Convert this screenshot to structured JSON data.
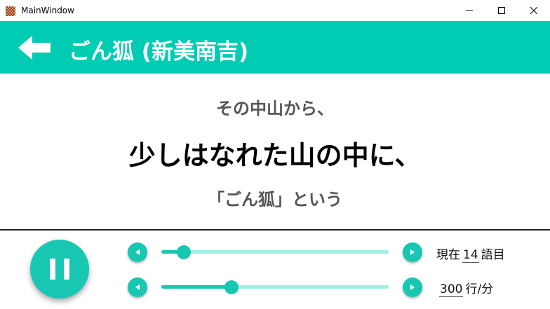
{
  "window": {
    "title": "MainWindow",
    "controls": [
      "minimize-icon",
      "maximize-icon",
      "close-icon"
    ]
  },
  "header": {
    "title": "ごん狐 (新美南吉)",
    "back_icon": "arrow-left-icon",
    "background_color": "#00ccb3"
  },
  "reading": {
    "previous_line": "その中山から、",
    "current_line": "少しはなれた山の中に、",
    "next_line": "「ごん狐」という"
  },
  "controls": {
    "play_state_icon": "pause-icon",
    "accent_color": "#17c7b1",
    "position_slider": {
      "value_fraction": 0.1
    },
    "speed_slider": {
      "value_fraction": 0.31
    },
    "current_word": {
      "prefix": "現在",
      "value": "14",
      "suffix": "語目"
    },
    "speed": {
      "value": "300",
      "suffix": "行/分"
    }
  }
}
